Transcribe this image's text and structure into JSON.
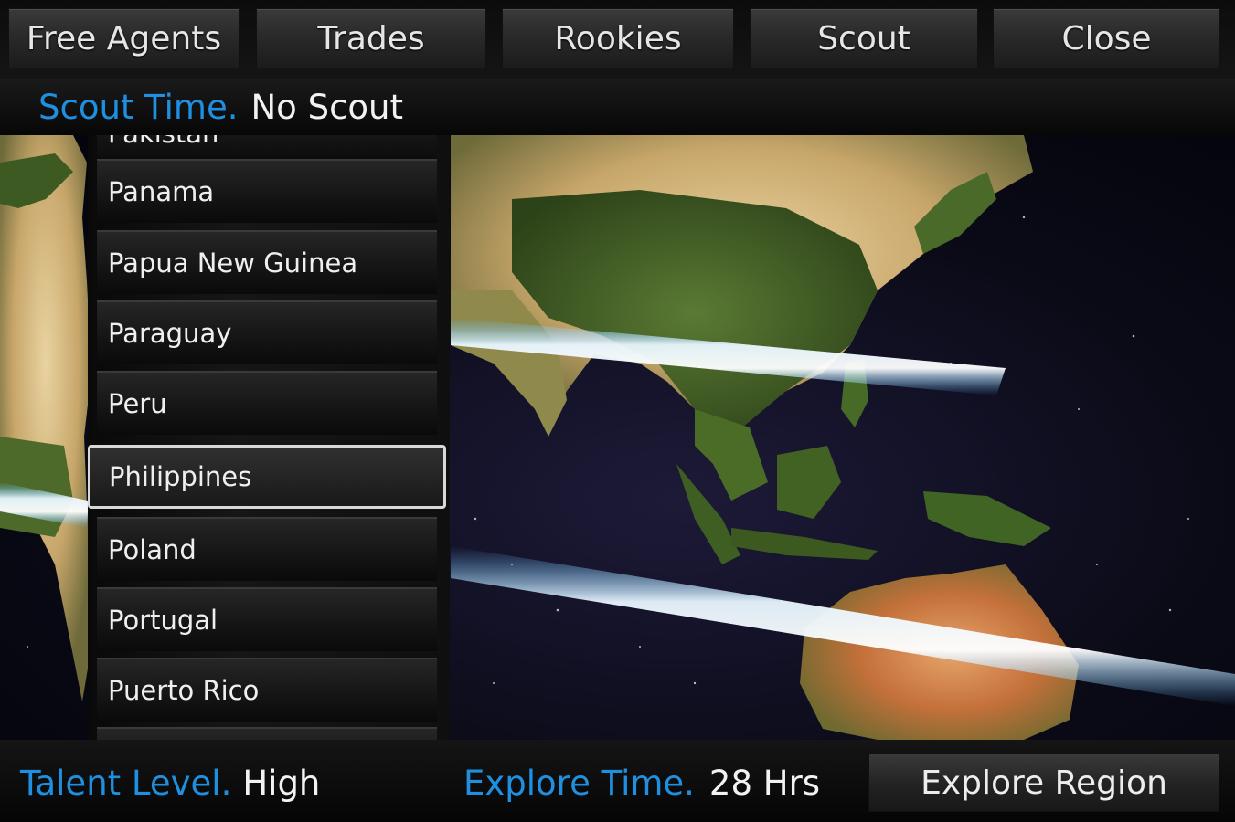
{
  "tabs": {
    "free_agents": "Free Agents",
    "trades": "Trades",
    "rookies": "Rookies",
    "scout": "Scout",
    "close": "Close"
  },
  "scout_time": {
    "label": "Scout Time.",
    "value": "No Scout"
  },
  "countries": {
    "partial": "Pakistan",
    "items": [
      "Panama",
      "Papua New Guinea",
      "Paraguay",
      "Peru",
      "Philippines",
      "Poland",
      "Portugal",
      "Puerto Rico"
    ],
    "selected": "Philippines"
  },
  "bottom": {
    "talent_label": "Talent Level.",
    "talent_value": "High",
    "explore_label": "Explore Time.",
    "explore_value": "28 Hrs",
    "explore_button": "Explore Region"
  },
  "colors": {
    "accent": "#1f8fe0",
    "text": "#f2f2f2"
  }
}
